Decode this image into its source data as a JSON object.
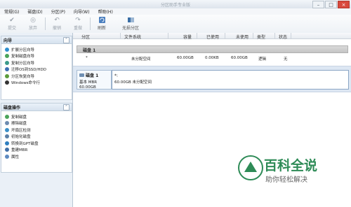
{
  "window": {
    "title": "分区助手专业版",
    "min": "–",
    "max": "□",
    "close": "×"
  },
  "menu": [
    "常规(G)",
    "磁盘(D)",
    "分区(P)",
    "向导(W)",
    "帮助(H)"
  ],
  "toolbar": {
    "items": [
      {
        "label": "提交",
        "icon": "check-icon",
        "enabled": false
      },
      {
        "label": "放弃",
        "icon": "discard-icon",
        "enabled": false
      },
      {
        "label": "撤销",
        "icon": "undo-icon",
        "enabled": false
      },
      {
        "label": "重做",
        "icon": "redo-icon",
        "enabled": false
      },
      {
        "label": "刷新",
        "icon": "refresh-icon",
        "enabled": true
      },
      {
        "label": "无损分区",
        "icon": "lossless-partition-icon",
        "enabled": true
      }
    ]
  },
  "wizard_panel": {
    "title": "向导",
    "items": [
      "扩展分区向导",
      "复制磁盘向导",
      "复制分区向导",
      "迁移OS到SSD/HDD",
      "分区恢复向导",
      "Windows命令行"
    ]
  },
  "disk_ops_panel": {
    "title": "磁盘操作",
    "items": [
      "复制磁盘",
      "擦除磁盘",
      "坏扇区检测",
      "初始化磁盘",
      "转换到GPT磁盘",
      "重建MBR",
      "属性"
    ]
  },
  "table": {
    "columns": [
      "分区",
      "文件系统",
      "容量",
      "已使用",
      "未使用",
      "类型",
      "状态"
    ],
    "group_label": "磁盘 1",
    "row": {
      "partition": "*",
      "filesystem": "未分配空间",
      "capacity": "60.00GB",
      "used": "0.00KB",
      "unused": "60.00GB",
      "type": "逻辑",
      "status": "无"
    }
  },
  "disk_map": {
    "disk_name": "磁盘 1",
    "disk_type": "基本 MBR",
    "disk_size": "60.00GB",
    "partition_letter": "*:",
    "partition_desc": "60.00GB 未分配空间"
  },
  "watermark": {
    "title": "百科全说",
    "subtitle": "助你轻松解决"
  },
  "colors": {
    "accent": "#3a6ea5",
    "panel_border": "#c2cfdc",
    "watermark_green": "#2e8b57"
  }
}
